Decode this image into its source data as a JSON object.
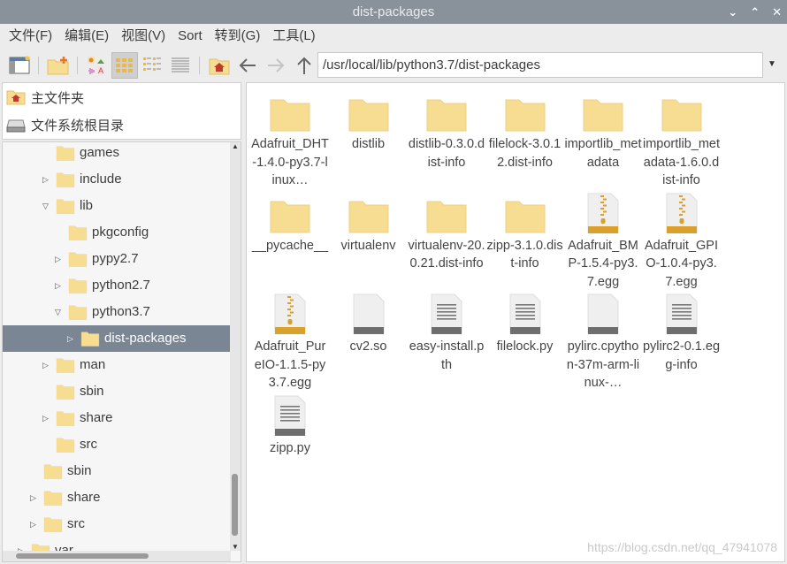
{
  "window": {
    "title": "dist-packages",
    "buttons": [
      "minimize",
      "maximize",
      "close"
    ]
  },
  "menu": [
    "文件(F)",
    "编辑(E)",
    "视图(V)",
    "Sort",
    "转到(G)",
    "工具(L)"
  ],
  "toolbar": {
    "path": "/usr/local/lib/python3.7/dist-packages",
    "icons": [
      "new-window-icon",
      "new-folder-icon",
      "thumbnail-view-icon",
      "icon-view-icon",
      "compact-view-icon",
      "detailed-list-icon",
      "home-icon",
      "back-icon",
      "forward-icon",
      "up-icon"
    ],
    "active_view": "icon-view"
  },
  "places": [
    {
      "label": "主文件夹",
      "icon": "home-folder-icon"
    },
    {
      "label": "文件系统根目录",
      "icon": "drive-icon"
    }
  ],
  "tree": [
    {
      "label": "games",
      "depth": 3,
      "arrow": ""
    },
    {
      "label": "include",
      "depth": 3,
      "arrow": "closed"
    },
    {
      "label": "lib",
      "depth": 3,
      "arrow": "open"
    },
    {
      "label": "pkgconfig",
      "depth": 4,
      "arrow": ""
    },
    {
      "label": "pypy2.7",
      "depth": 4,
      "arrow": "closed"
    },
    {
      "label": "python2.7",
      "depth": 4,
      "arrow": "closed"
    },
    {
      "label": "python3.7",
      "depth": 4,
      "arrow": "open"
    },
    {
      "label": "dist-packages",
      "depth": 5,
      "arrow": "closed",
      "selected": true
    },
    {
      "label": "man",
      "depth": 3,
      "arrow": "closed"
    },
    {
      "label": "sbin",
      "depth": 3,
      "arrow": ""
    },
    {
      "label": "share",
      "depth": 3,
      "arrow": "closed"
    },
    {
      "label": "src",
      "depth": 3,
      "arrow": ""
    },
    {
      "label": "sbin",
      "depth": 2,
      "arrow": ""
    },
    {
      "label": "share",
      "depth": 2,
      "arrow": "closed"
    },
    {
      "label": "src",
      "depth": 2,
      "arrow": "closed"
    },
    {
      "label": "var",
      "depth": 1,
      "arrow": "closed"
    }
  ],
  "files": [
    {
      "name": "Adafruit_DHT-1.4.0-py3.7-linux…",
      "type": "folder"
    },
    {
      "name": "distlib",
      "type": "folder"
    },
    {
      "name": "distlib-0.3.0.dist-info",
      "type": "folder"
    },
    {
      "name": "filelock-3.0.12.dist-info",
      "type": "folder"
    },
    {
      "name": "importlib_metadata",
      "type": "folder"
    },
    {
      "name": "importlib_metadata-1.6.0.dist-info",
      "type": "folder"
    },
    {
      "name": "__pycache__",
      "type": "folder"
    },
    {
      "name": "virtualenv",
      "type": "folder"
    },
    {
      "name": "virtualenv-20.0.21.dist-info",
      "type": "folder"
    },
    {
      "name": "zipp-3.1.0.dist-info",
      "type": "folder"
    },
    {
      "name": "Adafruit_BMP-1.5.4-py3.7.egg",
      "type": "archive"
    },
    {
      "name": "Adafruit_GPIO-1.0.4-py3.7.egg",
      "type": "archive"
    },
    {
      "name": "Adafruit_PureIO-1.1.5-py3.7.egg",
      "type": "archive"
    },
    {
      "name": "cv2.so",
      "type": "binary"
    },
    {
      "name": "easy-install.pth",
      "type": "text"
    },
    {
      "name": "filelock.py",
      "type": "text"
    },
    {
      "name": "pylirc.cpython-37m-arm-linux-…",
      "type": "binary"
    },
    {
      "name": "pylirc2-0.1.egg-info",
      "type": "text"
    },
    {
      "name": "zipp.py",
      "type": "text"
    }
  ],
  "watermark": "https://blog.csdn.net/qq_47941078",
  "colors": {
    "titlebar": "#89929b",
    "selection": "#7b8694",
    "folder": "#f7dd92"
  }
}
